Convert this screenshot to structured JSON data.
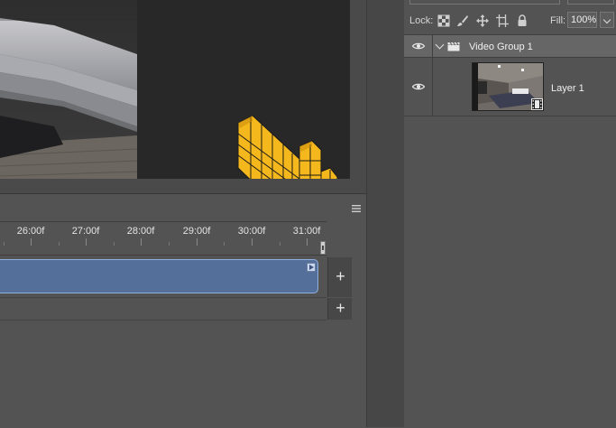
{
  "timeline": {
    "ruler_ticks": [
      "26:00f",
      "27:00f",
      "28:00f",
      "29:00f",
      "30:00f",
      "31:00f"
    ],
    "add_video_track_label": "+",
    "add_audio_track_label": "+"
  },
  "layers": {
    "lock_label": "Lock:",
    "fill_label": "Fill:",
    "fill_value": "100%",
    "group": {
      "name": "Video Group 1",
      "visible": true,
      "expanded": true
    },
    "layer": {
      "name": "Layer 1",
      "visible": true
    }
  },
  "colors": {
    "clip": "#54709a",
    "clip_border": "#8fb0de",
    "cursor_icon": "#f5b81c"
  },
  "icons": {
    "cursor": "hand-pointer-icon",
    "lock_pixels": "checker-icon",
    "lock_brush": "brush-icon",
    "lock_position": "move-icon",
    "lock_artboard": "artboard-icon",
    "lock_all": "padlock-icon",
    "visibility": "eye-icon",
    "group": "clapperboard-icon",
    "video_layer": "film-strip-icon",
    "panel_menu": "hamburger-menu-icon"
  }
}
